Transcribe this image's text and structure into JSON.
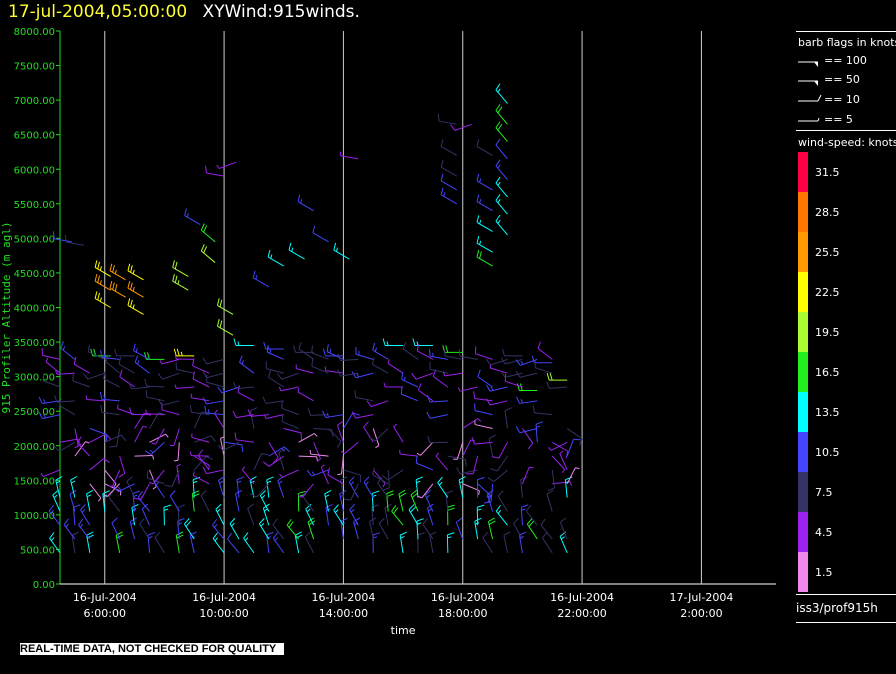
{
  "title": {
    "date": "17-jul-2004,05:00:00",
    "name": "XYWind:915winds."
  },
  "disclaimer": "REAL-TIME DATA, NOT CHECKED FOR QUALITY",
  "source": "iss3/prof915h",
  "legend": {
    "barb_title": "barb flags in knots",
    "barbs": [
      {
        "label": "== 100",
        "knots": 100
      },
      {
        "label": "== 50",
        "knots": 50
      },
      {
        "label": "== 10",
        "knots": 10
      },
      {
        "label": "== 5",
        "knots": 5
      }
    ],
    "speed_title": "wind-speed: knots",
    "speed_bins": [
      {
        "label": "31.5",
        "color": "#ff0044"
      },
      {
        "label": "28.5",
        "color": "#ff7700"
      },
      {
        "label": "25.5",
        "color": "#ff9900"
      },
      {
        "label": "22.5",
        "color": "#ffff00"
      },
      {
        "label": "19.5",
        "color": "#aaff33"
      },
      {
        "label": "16.5",
        "color": "#22ee22"
      },
      {
        "label": "13.5",
        "color": "#00ffff"
      },
      {
        "label": "10.5",
        "color": "#4444ff"
      },
      {
        "label": "7.5",
        "color": "#333366"
      },
      {
        "label": "4.5",
        "color": "#9922ee"
      },
      {
        "label": "1.5",
        "color": "#ee88ee"
      }
    ]
  },
  "chart_data": {
    "type": "scatter",
    "ylabel": "915 Profiler Altitude (m agl)",
    "xlabel": "time",
    "ylim": [
      0,
      8000
    ],
    "yticks": [
      "0.00",
      "500.00",
      "1000.00",
      "1500.00",
      "2000.00",
      "2500.00",
      "3000.00",
      "3500.00",
      "4000.00",
      "4500.00",
      "5000.00",
      "5500.00",
      "6000.00",
      "6500.00",
      "7000.00",
      "7500.00",
      "8000.00"
    ],
    "xlim": [
      4.5,
      28.5
    ],
    "xticks": [
      {
        "hour": 6,
        "date": "16-Jul-2004",
        "time": "6:00:00"
      },
      {
        "hour": 10,
        "date": "16-Jul-2004",
        "time": "10:00:00"
      },
      {
        "hour": 14,
        "date": "16-Jul-2004",
        "time": "14:00:00"
      },
      {
        "hour": 18,
        "date": "16-Jul-2004",
        "time": "18:00:00"
      },
      {
        "hour": 22,
        "date": "16-Jul-2004",
        "time": "22:00:00"
      },
      {
        "hour": 26,
        "date": "17-Jul-2004",
        "time": "2:00:00"
      }
    ],
    "grid": "vertical",
    "series_note": "wind barbs colored by wind speed (knots)",
    "barbs": [
      {
        "t": 4.9,
        "alt": 4950,
        "spd": 12,
        "dir": 280
      },
      {
        "t": 5.3,
        "alt": 4900,
        "spd": 9,
        "dir": 280
      },
      {
        "t": 6.2,
        "alt": 4450,
        "spd": 26,
        "dir": 300
      },
      {
        "t": 6.2,
        "alt": 4250,
        "spd": 27,
        "dir": 300
      },
      {
        "t": 6.2,
        "alt": 4000,
        "spd": 24,
        "dir": 300
      },
      {
        "t": 6.7,
        "alt": 4400,
        "spd": 27,
        "dir": 300
      },
      {
        "t": 6.7,
        "alt": 4150,
        "spd": 28,
        "dir": 300
      },
      {
        "t": 7.3,
        "alt": 4400,
        "spd": 26,
        "dir": 300
      },
      {
        "t": 7.3,
        "alt": 4150,
        "spd": 27,
        "dir": 300
      },
      {
        "t": 7.3,
        "alt": 3900,
        "spd": 26,
        "dir": 300
      },
      {
        "t": 8.8,
        "alt": 4450,
        "spd": 22,
        "dir": 300
      },
      {
        "t": 8.8,
        "alt": 4250,
        "spd": 23,
        "dir": 300
      },
      {
        "t": 9.7,
        "alt": 4950,
        "spd": 18,
        "dir": 310
      },
      {
        "t": 9.7,
        "alt": 4650,
        "spd": 22,
        "dir": 310
      },
      {
        "t": 9.2,
        "alt": 5200,
        "spd": 14,
        "dir": 300
      },
      {
        "t": 10.3,
        "alt": 3900,
        "spd": 22,
        "dir": 300
      },
      {
        "t": 10.3,
        "alt": 3600,
        "spd": 21,
        "dir": 300
      },
      {
        "t": 10.0,
        "alt": 5900,
        "spd": 8,
        "dir": 280
      },
      {
        "t": 10.4,
        "alt": 6100,
        "spd": 7,
        "dir": 250
      },
      {
        "t": 13.0,
        "alt": 5400,
        "spd": 13,
        "dir": 300
      },
      {
        "t": 12.0,
        "alt": 4600,
        "spd": 15,
        "dir": 300
      },
      {
        "t": 12.7,
        "alt": 4700,
        "spd": 15,
        "dir": 300
      },
      {
        "t": 11.5,
        "alt": 4300,
        "spd": 13,
        "dir": 300
      },
      {
        "t": 13.5,
        "alt": 4950,
        "spd": 12,
        "dir": 300
      },
      {
        "t": 14.2,
        "alt": 4700,
        "spd": 16,
        "dir": 300
      },
      {
        "t": 14.5,
        "alt": 6150,
        "spd": 7,
        "dir": 280
      },
      {
        "t": 17.8,
        "alt": 6650,
        "spd": 9,
        "dir": 280
      },
      {
        "t": 18.3,
        "alt": 6650,
        "spd": 8,
        "dir": 250
      },
      {
        "t": 17.8,
        "alt": 6200,
        "spd": 11,
        "dir": 300
      },
      {
        "t": 17.8,
        "alt": 5900,
        "spd": 11,
        "dir": 300
      },
      {
        "t": 17.8,
        "alt": 5700,
        "spd": 12,
        "dir": 300
      },
      {
        "t": 17.8,
        "alt": 5500,
        "spd": 13,
        "dir": 300
      },
      {
        "t": 19.0,
        "alt": 6200,
        "spd": 10,
        "dir": 300
      },
      {
        "t": 19.0,
        "alt": 5700,
        "spd": 13,
        "dir": 300
      },
      {
        "t": 19.0,
        "alt": 5400,
        "spd": 14,
        "dir": 300
      },
      {
        "t": 19.0,
        "alt": 5100,
        "spd": 16,
        "dir": 300
      },
      {
        "t": 19.0,
        "alt": 4800,
        "spd": 17,
        "dir": 300
      },
      {
        "t": 19.0,
        "alt": 4600,
        "spd": 18,
        "dir": 300
      },
      {
        "t": 19.5,
        "alt": 6950,
        "spd": 17,
        "dir": 320
      },
      {
        "t": 19.5,
        "alt": 6650,
        "spd": 18,
        "dir": 320
      },
      {
        "t": 19.5,
        "alt": 6400,
        "spd": 18,
        "dir": 320
      },
      {
        "t": 19.5,
        "alt": 6150,
        "spd": 12,
        "dir": 320
      },
      {
        "t": 19.5,
        "alt": 5850,
        "spd": 14,
        "dir": 320
      },
      {
        "t": 19.5,
        "alt": 5600,
        "spd": 16,
        "dir": 320
      },
      {
        "t": 19.5,
        "alt": 5350,
        "spd": 16,
        "dir": 320
      },
      {
        "t": 19.5,
        "alt": 5050,
        "spd": 17,
        "dir": 320
      },
      {
        "t": 6.2,
        "alt": 3300,
        "spd": 20,
        "dir": 270
      },
      {
        "t": 7.0,
        "alt": 3300,
        "spd": 9,
        "dir": 270
      },
      {
        "t": 8.0,
        "alt": 3250,
        "spd": 18,
        "dir": 270
      },
      {
        "t": 9.0,
        "alt": 3300,
        "spd": 24,
        "dir": 270
      },
      {
        "t": 11.0,
        "alt": 3450,
        "spd": 15,
        "dir": 270
      },
      {
        "t": 12.0,
        "alt": 3400,
        "spd": 14,
        "dir": 270
      },
      {
        "t": 13.0,
        "alt": 3350,
        "spd": 10,
        "dir": 270
      },
      {
        "t": 14.0,
        "alt": 3300,
        "spd": 12,
        "dir": 270
      },
      {
        "t": 16.0,
        "alt": 3450,
        "spd": 16,
        "dir": 270
      },
      {
        "t": 17.0,
        "alt": 3450,
        "spd": 15,
        "dir": 270
      },
      {
        "t": 18.0,
        "alt": 3350,
        "spd": 18,
        "dir": 270
      },
      {
        "t": 20.0,
        "alt": 3300,
        "spd": 11,
        "dir": 270
      },
      {
        "t": 21.0,
        "alt": 3200,
        "spd": 12,
        "dir": 270
      },
      {
        "t": 21.5,
        "alt": 2950,
        "spd": 22,
        "dir": 270
      },
      {
        "t": 20.5,
        "alt": 2800,
        "spd": 20,
        "dir": 270
      }
    ],
    "dense_region": {
      "t_start": 4.5,
      "t_end": 21.5,
      "alt_min": 450,
      "alt_max": 3300
    }
  }
}
